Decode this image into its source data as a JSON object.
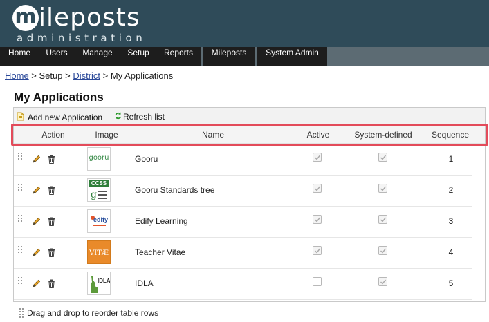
{
  "logo": {
    "main_letter": "m",
    "main_rest": "ileposts",
    "sub": "administration"
  },
  "nav": {
    "items": [
      "Home",
      "Users",
      "Manage",
      "Setup",
      "Reports",
      "Mileposts",
      "System Admin"
    ]
  },
  "breadcrumb": {
    "home": "Home",
    "sep1": " > ",
    "setup": "Setup",
    "sep2": " > ",
    "district": "District",
    "sep3": " > ",
    "current": "My Applications"
  },
  "page": {
    "title": "My Applications"
  },
  "toolbar": {
    "add_label": "Add new Application",
    "refresh_label": "Refresh list"
  },
  "columns": {
    "action": "Action",
    "image": "Image",
    "name": "Name",
    "active": "Active",
    "system_defined": "System-defined",
    "sequence": "Sequence"
  },
  "rows": [
    {
      "name": "Gooru",
      "logo_text": "gooru",
      "active": true,
      "system_defined": true,
      "sequence": "1"
    },
    {
      "name": "Gooru Standards tree",
      "logo_text": "CCSS",
      "active": true,
      "system_defined": true,
      "sequence": "2"
    },
    {
      "name": "Edify Learning",
      "logo_text": "edify",
      "active": true,
      "system_defined": true,
      "sequence": "3"
    },
    {
      "name": "Teacher Vitae",
      "logo_text": "VITÆ",
      "active": true,
      "system_defined": true,
      "sequence": "4"
    },
    {
      "name": "IDLA",
      "logo_text": "IDLA",
      "active": false,
      "system_defined": true,
      "sequence": "5"
    }
  ],
  "footer": {
    "hint": "Drag and drop to reorder table rows"
  },
  "colors": {
    "header_bg": "#2f4b59",
    "nav_bg": "#1d1d1d",
    "highlight": "#e34b5a",
    "link": "#2c4a9a"
  }
}
